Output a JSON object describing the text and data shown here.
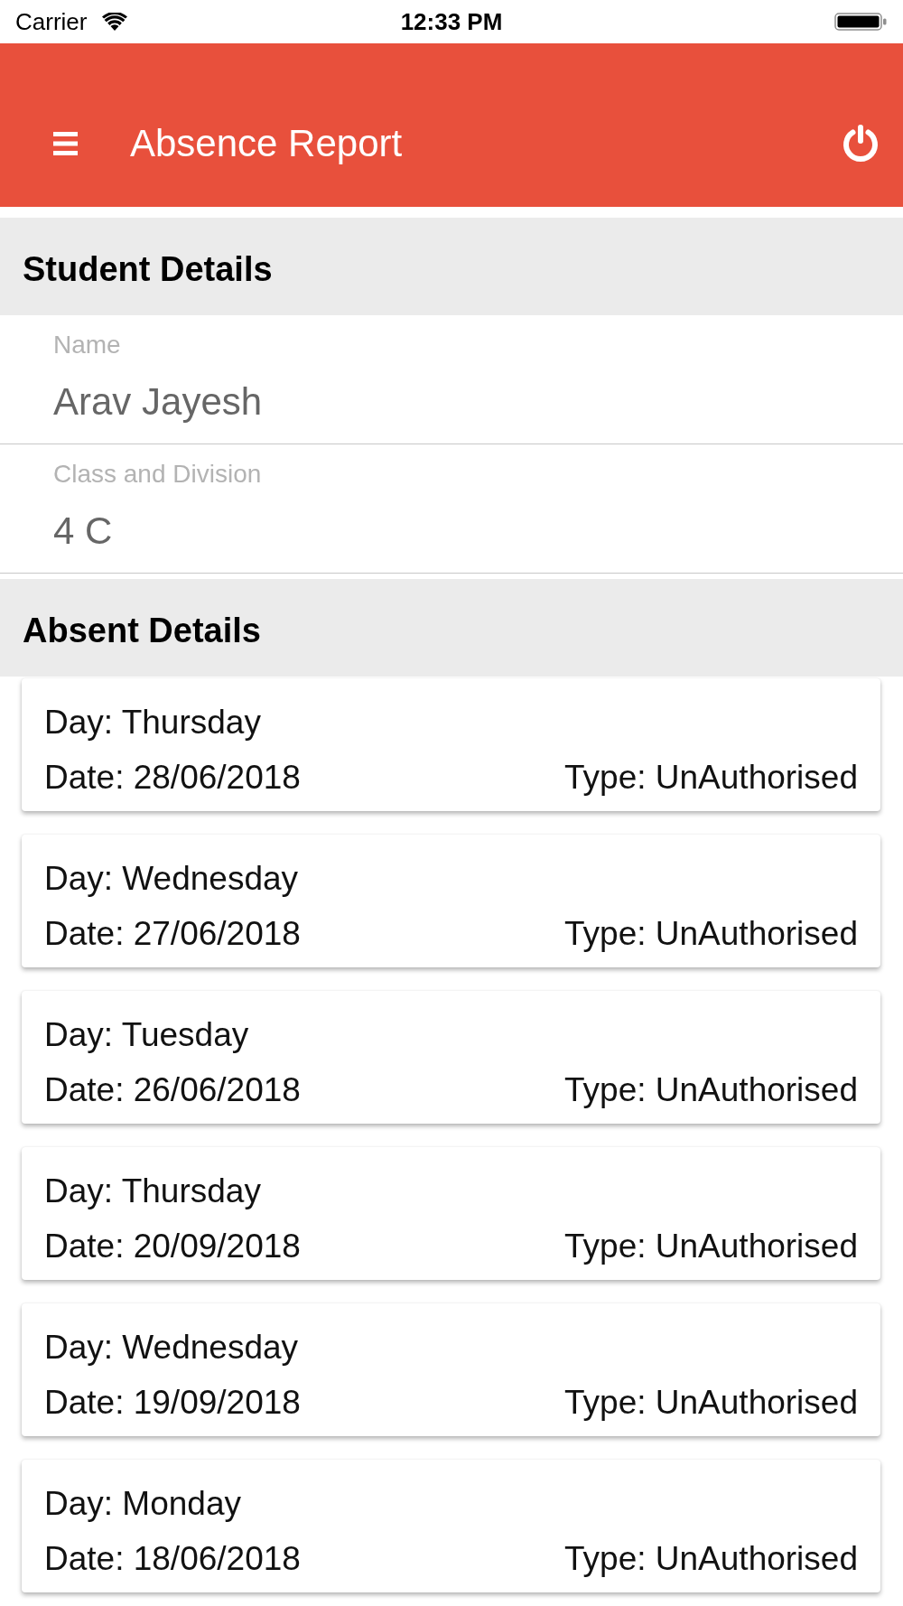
{
  "status_bar": {
    "carrier": "Carrier",
    "time": "12:33 PM"
  },
  "app_bar": {
    "title": "Absence Report"
  },
  "student_details": {
    "heading": "Student Details",
    "fields": [
      {
        "label": "Name",
        "value": "Arav Jayesh"
      },
      {
        "label": "Class and Division",
        "value": "4 C"
      }
    ]
  },
  "absent_details": {
    "heading": "Absent Details",
    "records": [
      {
        "day": "Day: Thursday",
        "date": "Date: 28/06/2018",
        "type": "Type: UnAuthorised"
      },
      {
        "day": "Day: Wednesday",
        "date": "Date: 27/06/2018",
        "type": "Type: UnAuthorised"
      },
      {
        "day": "Day: Tuesday",
        "date": "Date: 26/06/2018",
        "type": "Type: UnAuthorised"
      },
      {
        "day": "Day: Thursday",
        "date": "Date: 20/09/2018",
        "type": "Type: UnAuthorised"
      },
      {
        "day": "Day: Wednesday",
        "date": "Date: 19/09/2018",
        "type": "Type: UnAuthorised"
      },
      {
        "day": "Day: Monday",
        "date": "Date: 18/06/2018",
        "type": "Type: UnAuthorised"
      }
    ]
  }
}
